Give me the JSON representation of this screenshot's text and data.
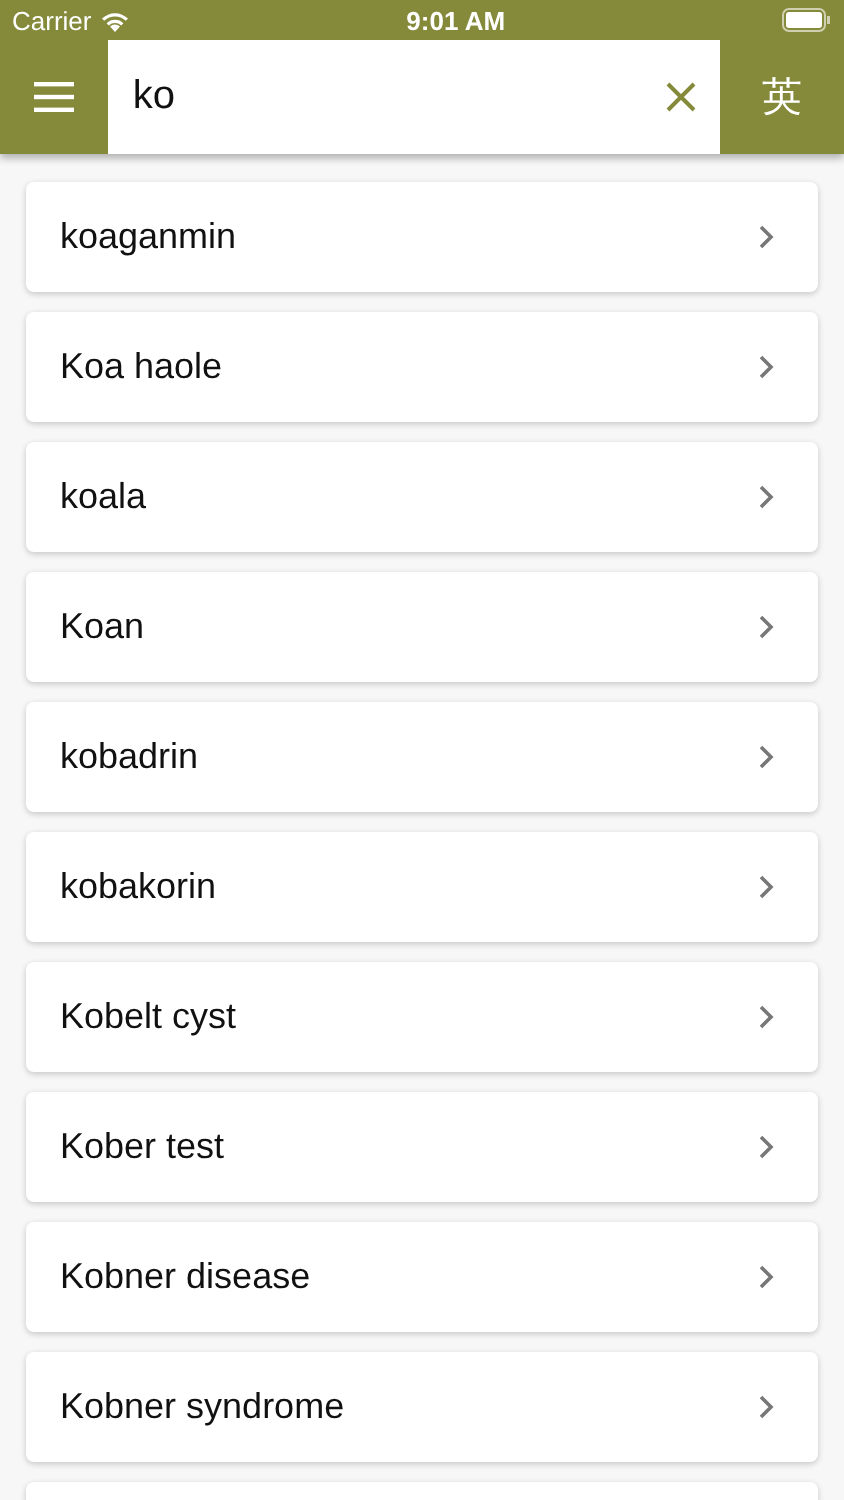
{
  "status_bar": {
    "carrier": "Carrier",
    "time": "9:01 AM"
  },
  "search": {
    "value": "ko"
  },
  "language_button": {
    "label": "英"
  },
  "results": [
    {
      "term": "koaganmin"
    },
    {
      "term": "Koa haole"
    },
    {
      "term": "koala"
    },
    {
      "term": "Koan"
    },
    {
      "term": "kobadrin"
    },
    {
      "term": "kobakorin"
    },
    {
      "term": "Kobelt cyst"
    },
    {
      "term": "Kober test"
    },
    {
      "term": "Kobner disease"
    },
    {
      "term": "Kobner syndrome"
    }
  ]
}
